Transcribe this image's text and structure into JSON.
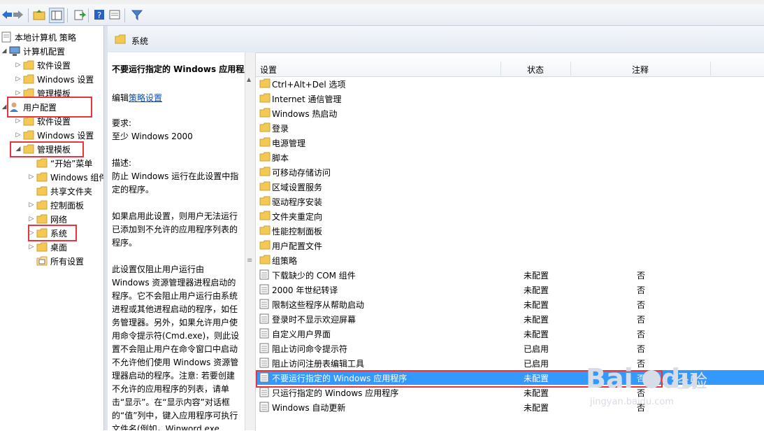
{
  "toolbar": {
    "icons": [
      "back-arrow-icon",
      "forward-arrow-icon",
      "up-folder-icon",
      "show-hide-tree-icon",
      "export-list-icon",
      "help-icon",
      "properties-icon",
      "filter-icon"
    ]
  },
  "tree": {
    "items": [
      {
        "label": "本地计算机 策略"
      },
      {
        "label": "计算机配置"
      },
      {
        "label": "软件设置"
      },
      {
        "label": "Windows 设置"
      },
      {
        "label": "管理模板"
      },
      {
        "label": "用户配置"
      },
      {
        "label": "软件设置"
      },
      {
        "label": "Windows 设置"
      },
      {
        "label": "管理模板"
      },
      {
        "label": "“开始”菜单"
      },
      {
        "label": "Windows 组件"
      },
      {
        "label": "共享文件夹"
      },
      {
        "label": "控制面板"
      },
      {
        "label": "网络"
      },
      {
        "label": "系统"
      },
      {
        "label": "桌面"
      },
      {
        "label": "所有设置"
      }
    ]
  },
  "content": {
    "header_title": "系统",
    "description": {
      "title": "不要运行指定的 Windows 应用程序",
      "edit_prefix": "编辑",
      "edit_link": "策略设置",
      "req_label": "要求:",
      "req_value": "至少 Windows 2000",
      "desc_label": "描述:",
      "desc_1": "防止 Windows 运行在此设置中指定的程序。",
      "desc_2": "如果启用此设置，则用户无法运行已添加到不允许的应用程序列表的程序。",
      "desc_3": "此设置仅阻止用户运行由 Windows 资源管理器进程启动的程序。它不会阻止用户运行由系统进程或其他进程启动的程序，如任务管理器。另外，如果允许用户使用命令提示符(Cmd.exe)，则此设置不会阻止用户在命令窗口中启动不允许他们使用 Windows 资源管理器启动的程序。注意: 若要创建不允许的应用程序的列表，请单击“显示”。在“显示内容”对话框的“值”列中，键入应用程序可执行文件名(例如，Winword.exe"
    },
    "list": {
      "columns": [
        "设置",
        "状态",
        "注释"
      ],
      "rows": [
        {
          "name": "Ctrl+Alt+Del 选项",
          "state": "",
          "note": "",
          "type": "folder"
        },
        {
          "name": "Internet 通信管理",
          "state": "",
          "note": "",
          "type": "folder"
        },
        {
          "name": "Windows 热启动",
          "state": "",
          "note": "",
          "type": "folder"
        },
        {
          "name": "登录",
          "state": "",
          "note": "",
          "type": "folder"
        },
        {
          "name": "电源管理",
          "state": "",
          "note": "",
          "type": "folder"
        },
        {
          "name": "脚本",
          "state": "",
          "note": "",
          "type": "folder"
        },
        {
          "name": "可移动存储访问",
          "state": "",
          "note": "",
          "type": "folder"
        },
        {
          "name": "区域设置服务",
          "state": "",
          "note": "",
          "type": "folder"
        },
        {
          "name": "驱动程序安装",
          "state": "",
          "note": "",
          "type": "folder"
        },
        {
          "name": "文件夹重定向",
          "state": "",
          "note": "",
          "type": "folder"
        },
        {
          "name": "性能控制面板",
          "state": "",
          "note": "",
          "type": "folder"
        },
        {
          "name": "用户配置文件",
          "state": "",
          "note": "",
          "type": "folder"
        },
        {
          "name": "组策略",
          "state": "",
          "note": "",
          "type": "folder"
        },
        {
          "name": "下载缺少的 COM 组件",
          "state": "未配置",
          "note": "否",
          "type": "setting"
        },
        {
          "name": "2000 年世纪转译",
          "state": "未配置",
          "note": "否",
          "type": "setting"
        },
        {
          "name": "限制这些程序从帮助启动",
          "state": "未配置",
          "note": "否",
          "type": "setting"
        },
        {
          "name": "登录时不显示欢迎屏幕",
          "state": "未配置",
          "note": "否",
          "type": "setting"
        },
        {
          "name": "自定义用户界面",
          "state": "未配置",
          "note": "否",
          "type": "setting"
        },
        {
          "name": "阻止访问命令提示符",
          "state": "已启用",
          "note": "否",
          "type": "setting"
        },
        {
          "name": "阻止访问注册表编辑工具",
          "state": "已启用",
          "note": "否",
          "type": "setting"
        },
        {
          "name": "不要运行指定的 Windows 应用程序",
          "state": "未配置",
          "note": "否",
          "type": "setting",
          "selected": true
        },
        {
          "name": "只运行指定的 Windows 应用程序",
          "state": "未配置",
          "note": "否",
          "type": "setting"
        },
        {
          "name": "Windows 自动更新",
          "state": "未配置",
          "note": "否",
          "type": "setting"
        }
      ]
    }
  },
  "watermark": {
    "brand": "Bai",
    "brand2": "du",
    "suffix": "经验",
    "url": "jingyan.baidu.com"
  },
  "colors": {
    "highlight_red": "#e8343e",
    "selection_blue": "#3399ff",
    "folder_yellow": "#f3c954"
  }
}
